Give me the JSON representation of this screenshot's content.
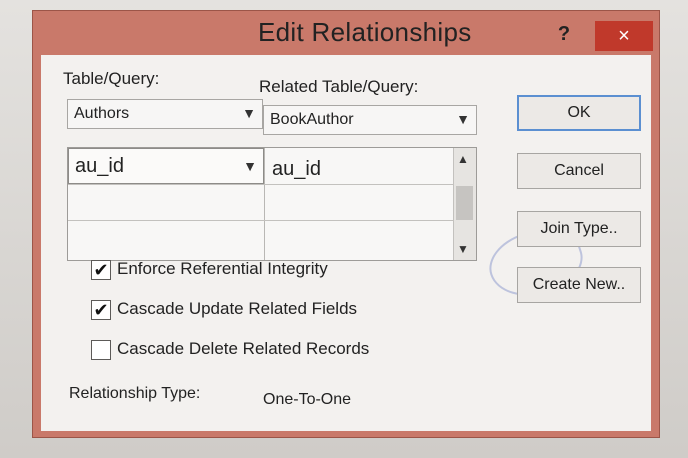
{
  "window": {
    "title": "Edit Relationships",
    "help_glyph": "?",
    "close_glyph": "×"
  },
  "labels": {
    "table_query": "Table/Query:",
    "related_table_query": "Related Table/Query:"
  },
  "table_select": {
    "value": "Authors"
  },
  "related_table_select": {
    "value": "BookAuthor"
  },
  "field_grid": {
    "rows": [
      {
        "left": "au_id",
        "right": "au_id"
      },
      {
        "left": "",
        "right": ""
      },
      {
        "left": "",
        "right": ""
      }
    ]
  },
  "buttons": {
    "ok": "OK",
    "cancel": "Cancel",
    "join_type": "Join Type..",
    "create_new": "Create New.."
  },
  "options": [
    {
      "label": "Enforce Referential Integrity",
      "checked": true
    },
    {
      "label": "Cascade Update Related Fields",
      "checked": true
    },
    {
      "label": "Cascade Delete Related Records",
      "checked": false
    }
  ],
  "relationship": {
    "label": "Relationship Type:",
    "value": "One-To-One"
  },
  "icons": {
    "dropdown": "chevron-down-icon",
    "scroll_up": "up-arrow-icon",
    "scroll_down": "down-arrow-icon",
    "check": "checkmark-icon"
  },
  "colors": {
    "titlebar": "#c9796a",
    "close_button": "#c0392b",
    "ok_border": "#5b8fd1"
  }
}
